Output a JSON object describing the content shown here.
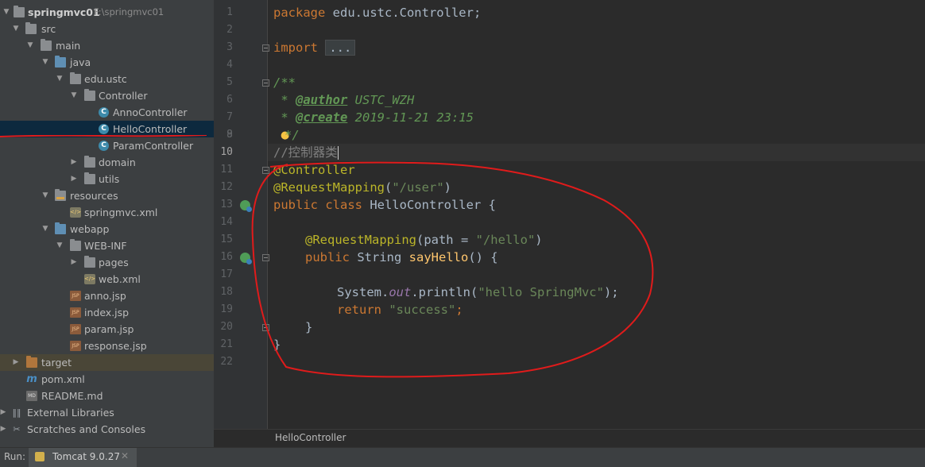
{
  "project": {
    "name": "springmvc01",
    "path": "F:\\springmvc01",
    "items": [
      "src",
      "main",
      "java",
      "edu.ustc",
      "Controller",
      "AnnoController",
      "HelloController",
      "ParamController",
      "domain",
      "utils",
      "resources",
      "springmvc.xml",
      "webapp",
      "WEB-INF",
      "pages",
      "web.xml",
      "anno.jsp",
      "index.jsp",
      "param.jsp",
      "response.jsp",
      "target",
      "pom.xml",
      "README.md",
      "External Libraries",
      "Scratches and Consoles"
    ]
  },
  "editor": {
    "line_numbers": [
      "1",
      "2",
      "3",
      "4",
      "5",
      "6",
      "7",
      "8",
      "9",
      "10",
      "11",
      "12",
      "13",
      "14",
      "15",
      "16",
      "17",
      "18",
      "19",
      "20",
      "21",
      "22"
    ],
    "code": {
      "l1_kw": "package",
      "l1_rest": " edu.ustc.Controller;",
      "l3_kw": "import",
      "l3_fold": "...",
      "l6": "/**",
      "l7_star": " * ",
      "l7_tag": "@author",
      "l7_val": " USTC_WZH",
      "l8_star": " * ",
      "l8_tag": "@create",
      "l8_val": " 2019-11-21 23:15",
      "l9": "*/",
      "l10": "//控制器类",
      "l11": "@Controller",
      "l12_ann": "@RequestMapping",
      "l12_a": "(",
      "l12_str": "\"/user\"",
      "l12_b": ")",
      "l13_kw": "public class",
      "l13_rest": " HelloController {",
      "l15_ann": "@RequestMapping",
      "l15_a": "(path = ",
      "l15_str": "\"/hello\"",
      "l15_b": ")",
      "l16_kw": "public",
      "l16_type": " String ",
      "l16_fn": "sayHello",
      "l16_rest": "() {",
      "l18_a": "System.",
      "l18_fld": "out",
      "l18_b": ".println(",
      "l18_str": "\"hello SpringMvc\"",
      "l18_c": ");",
      "l19_kw": "return",
      "l19_str": " \"success\"",
      "l19_c": ";",
      "l20": "}",
      "l21": "}"
    }
  },
  "breadcrumb": "HelloController",
  "run": {
    "label": "Run:",
    "tab": "Tomcat 9.0.27",
    "close": "✕"
  },
  "colors": {
    "annotation_ink": "#e01b1b",
    "selection": "#0d293e"
  }
}
